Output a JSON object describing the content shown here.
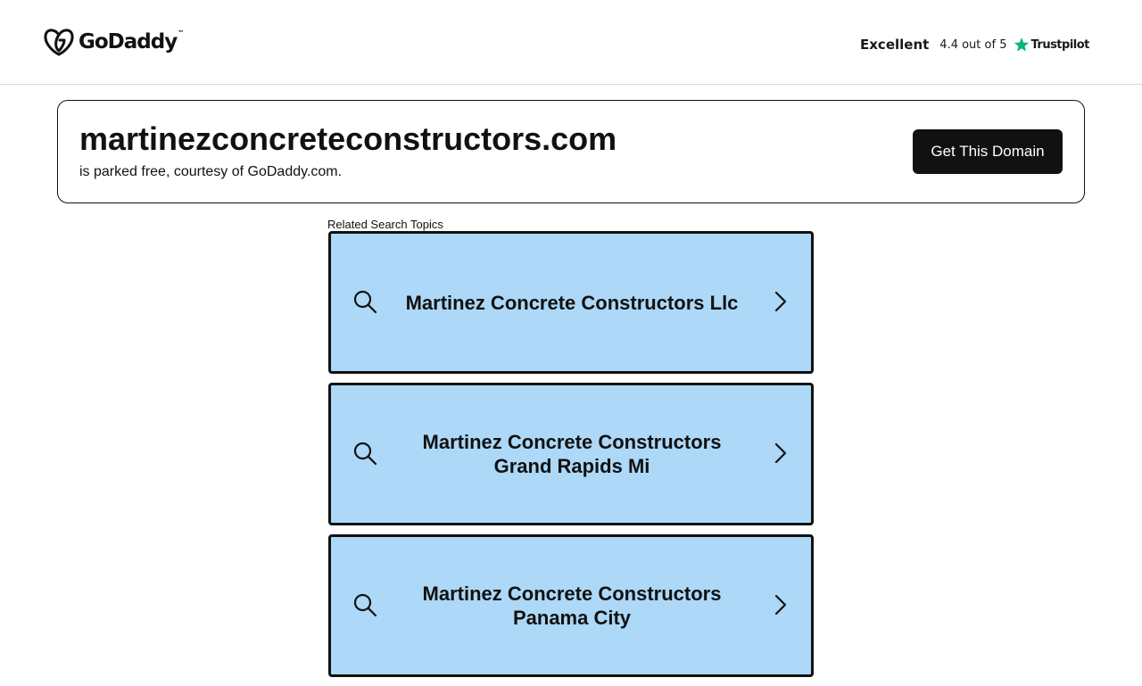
{
  "header": {
    "logo_text": "GoDaddy",
    "logo_tm": "™",
    "trustpilot": {
      "rating_word": "Excellent",
      "score_text": "4.4 out of 5",
      "brand": "Trustpilot",
      "star_color": "#00b67a",
      "icon": "star-icon"
    }
  },
  "domain_card": {
    "domain_name": "martinezconcreteconstructors.com",
    "subtitle": "is parked free, courtesy of GoDaddy.com.",
    "cta_label": "Get This Domain"
  },
  "related": {
    "label": "Related Search Topics",
    "topic_bg_color": "#add8f7",
    "topics": [
      {
        "label": "Martinez Concrete Constructors Llc",
        "icon": "search-icon",
        "trailing_icon": "chevron-right-icon"
      },
      {
        "label": "Martinez Concrete Constructors Grand Rapids Mi",
        "icon": "search-icon",
        "trailing_icon": "chevron-right-icon"
      },
      {
        "label": "Martinez Concrete Constructors Panama City",
        "icon": "search-icon",
        "trailing_icon": "chevron-right-icon"
      }
    ]
  }
}
